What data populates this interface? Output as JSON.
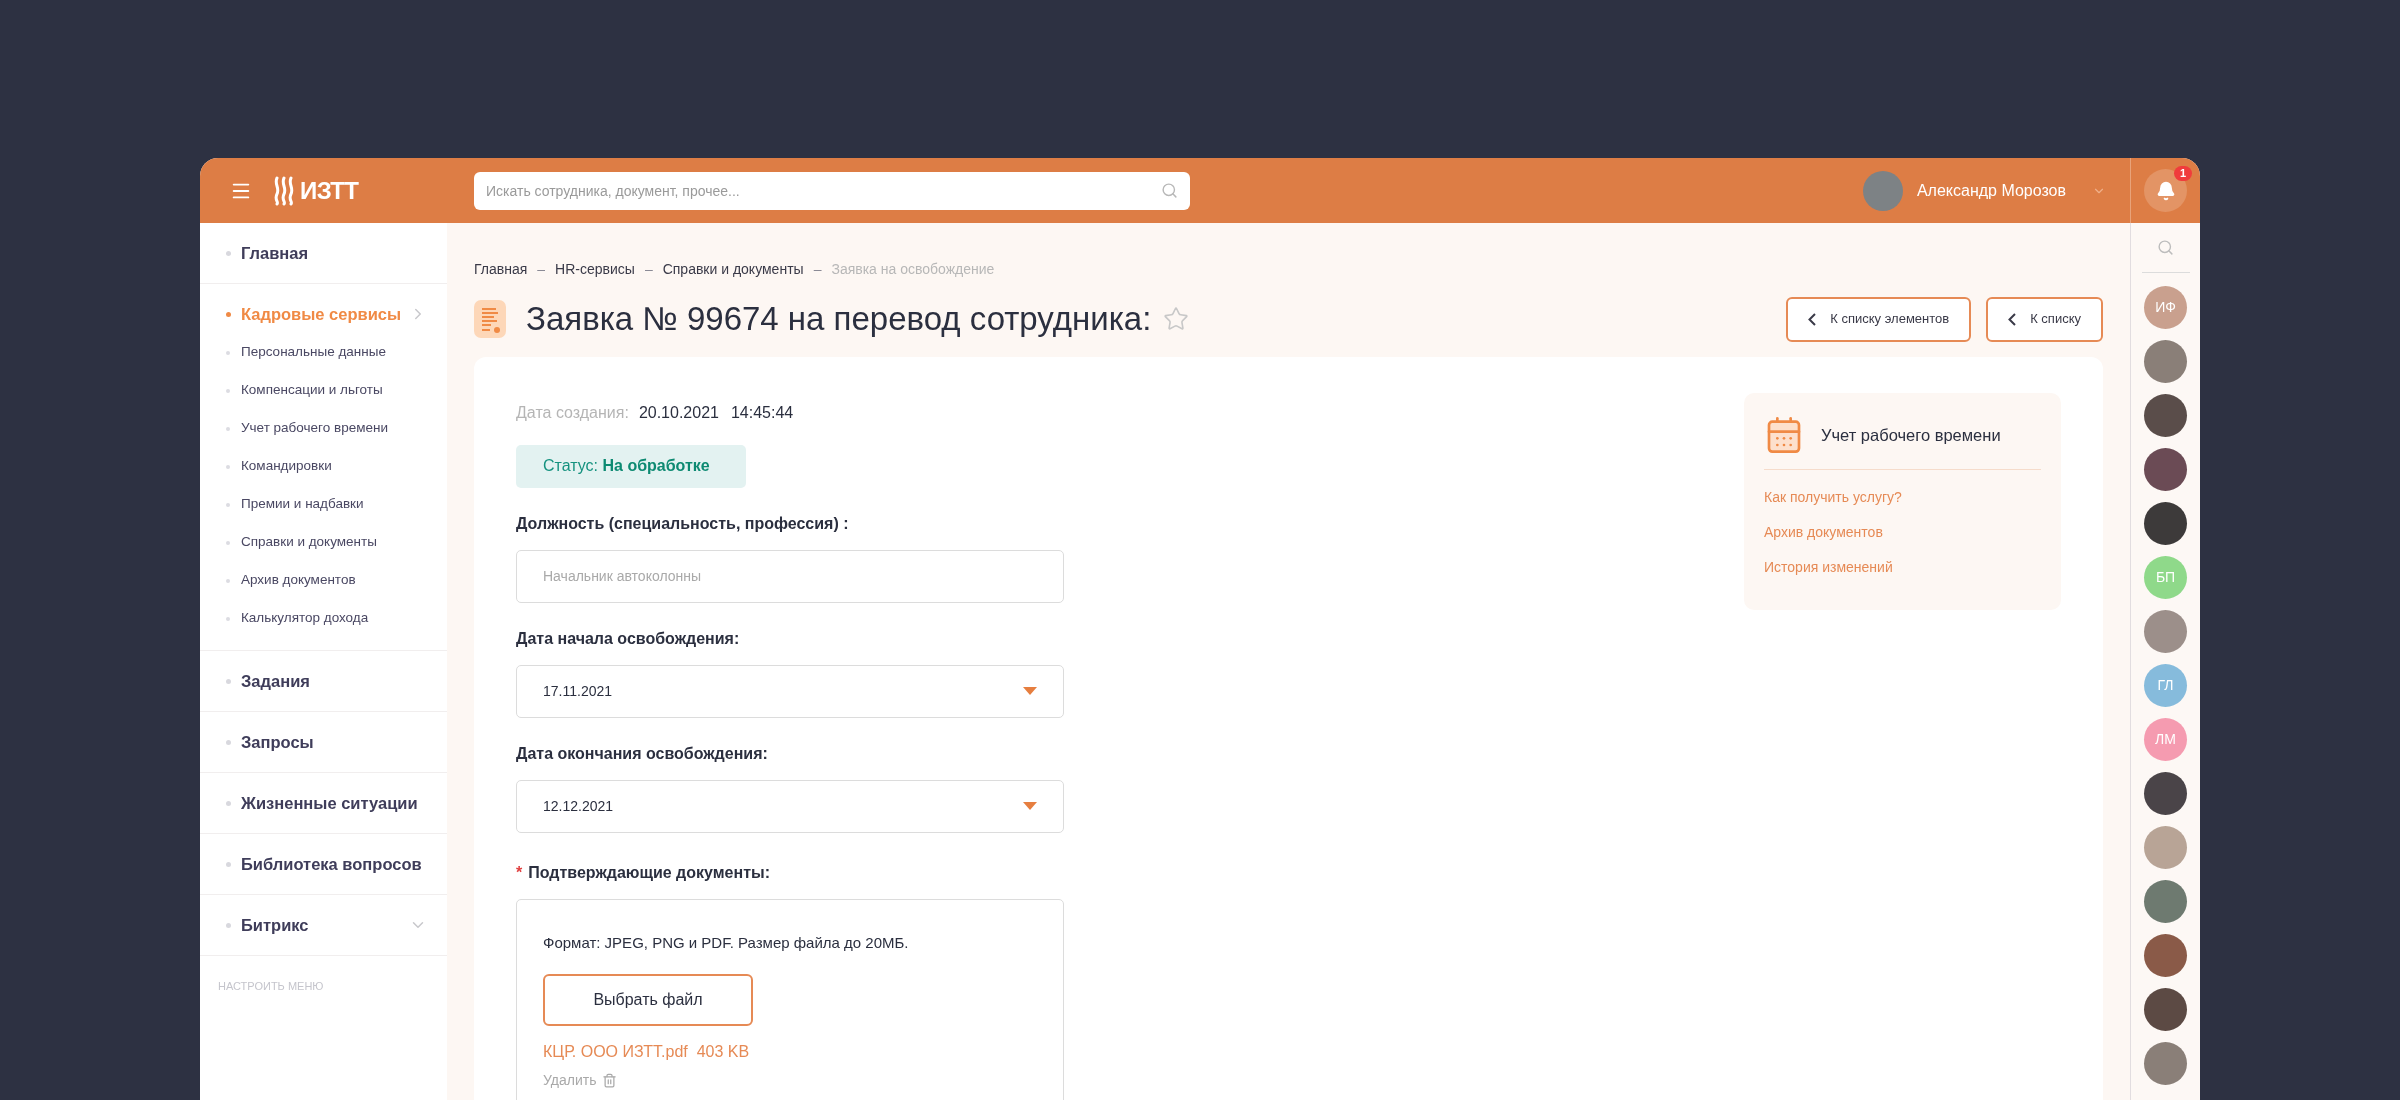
{
  "header": {
    "logo": "ИЗТТ",
    "search": {
      "placeholder": "Искать сотрудника, документ, прочее..."
    },
    "user": {
      "name": "Александр Морозов"
    },
    "notifications": {
      "count": "1"
    }
  },
  "sidebar": {
    "items": [
      {
        "label": "Главная",
        "selected": false
      },
      {
        "label": "Кадровые сервисы",
        "selected": true,
        "expanded": true,
        "children": [
          {
            "label": "Персональные данные"
          },
          {
            "label": "Компенсации и льготы"
          },
          {
            "label": "Учет рабочего времени"
          },
          {
            "label": "Командировки"
          },
          {
            "label": "Премии и надбавки"
          },
          {
            "label": "Справки и документы"
          },
          {
            "label": "Архив документов"
          },
          {
            "label": "Калькулятор дохода"
          }
        ]
      },
      {
        "label": "Задания",
        "selected": false
      },
      {
        "label": "Запросы",
        "selected": false
      },
      {
        "label": "Жизненные ситуации",
        "selected": false
      },
      {
        "label": "Библиотека вопросов",
        "selected": false
      },
      {
        "label": "Битрикс",
        "selected": false,
        "expanded": false
      }
    ],
    "settings_link": "НАСТРОИТЬ МЕНЮ"
  },
  "breadcrumbs": [
    {
      "label": "Главная",
      "current": false
    },
    {
      "separator": "–",
      "label": "HR-сервисы",
      "current": false
    },
    {
      "separator": "–",
      "label": "Справки и документы",
      "current": false
    },
    {
      "separator": "–",
      "label": "Заявка на освобождение",
      "current": true
    }
  ],
  "title": "Заявка № 99674 на перевод сотрудника:",
  "favorite": false,
  "nav_buttons": [
    "К списку элементов",
    "К списку"
  ],
  "request": {
    "created_label": "Дата создания:",
    "created_date": "20.10.2021",
    "created_time": "14:45:44",
    "status": {
      "label": "Статус:",
      "value": "На обработке"
    },
    "fields": [
      {
        "kind": "text",
        "label": "Должность (специальность, профессия) :",
        "placeholder": "Начальник автоколонны",
        "required": false
      },
      {
        "kind": "date",
        "label": "Дата начала освобождения:",
        "value": "17.11.2021",
        "required": false
      },
      {
        "kind": "date",
        "label": "Дата окончания освобождения:",
        "value": "12.12.2021",
        "required": false
      }
    ],
    "upload": {
      "label": "Подтверждающие документы:",
      "required": true,
      "required_mark": "*",
      "hint": "Формат: JPEG, PNG и PDF. Размер файла до 20МБ.",
      "button": "Выбрать файл",
      "file": {
        "name": "КЦР. ООО ИЗТТ.pdf",
        "size": "403 KB"
      },
      "delete": "Удалить"
    }
  },
  "info_panel": {
    "title": "Учет рабочего времени",
    "links": [
      "Как получить услугу?",
      "Архив документов",
      "История изменений"
    ]
  },
  "contacts": [
    {
      "kind": "initials",
      "initials": "ИФ",
      "color": "#c9a08e"
    },
    {
      "kind": "photo"
    },
    {
      "kind": "photo"
    },
    {
      "kind": "photo"
    },
    {
      "kind": "photo"
    },
    {
      "kind": "initials",
      "initials": "БП",
      "color": "#8fd98a"
    },
    {
      "kind": "photo"
    },
    {
      "kind": "initials",
      "initials": "ГЛ",
      "color": "#86bbdc"
    },
    {
      "kind": "initials",
      "initials": "ЛМ",
      "color": "#f59bb0"
    },
    {
      "kind": "photo"
    },
    {
      "kind": "photo"
    },
    {
      "kind": "photo"
    },
    {
      "kind": "photo"
    },
    {
      "kind": "photo"
    },
    {
      "kind": "photo"
    }
  ]
}
